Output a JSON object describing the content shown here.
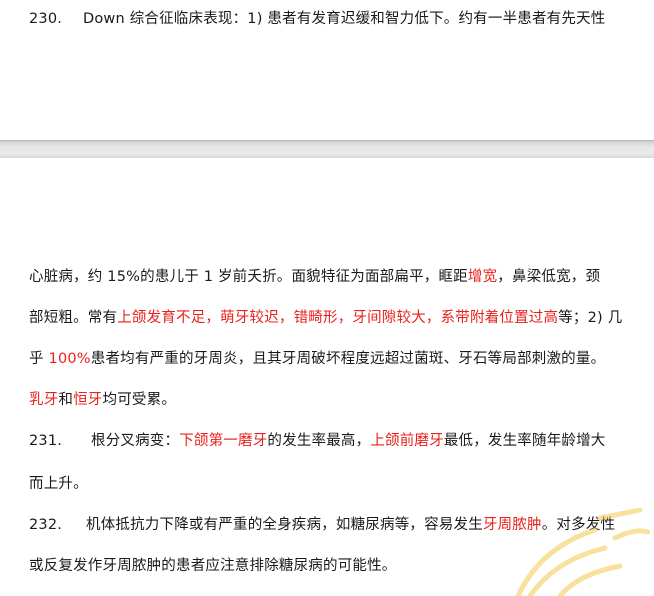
{
  "page1": {
    "item230_num": "230.",
    "item230_text": "Down 综合征临床表现：1) 患者有发育迟缓和智力低下。约有一半患者有先天性"
  },
  "page2": {
    "l1": [
      "心脏病，约 15%的患儿于 1 岁前夭折。面貌特征为面部扁平，眶距",
      "增宽",
      "，鼻梁低宽，颈"
    ],
    "l2": [
      "部短粗。常有",
      "上颌发育不足，萌牙较迟，错畸形，牙间隙较大，系带附着位置过高",
      "等；2) 几"
    ],
    "l3": [
      "乎 ",
      "100%",
      "患者均有严重的牙周炎，且其牙周破坏程度远超过菌斑、牙石等局部刺激的量。"
    ],
    "l4": [
      "乳牙",
      "和",
      "恒牙",
      "均可受累。"
    ],
    "item231_num": "231.",
    "l5": [
      "根分叉病变：",
      "下颌第一磨牙",
      "的发生率最高，",
      "上颌前磨牙",
      "最低，发生率随年龄增大"
    ],
    "l6": "而上升。",
    "item232_num": "232.",
    "l7": [
      "机体抵抗力下降或有严重的全身疾病，如糖尿病等，容易发生",
      "牙周脓肿",
      "。对多发性"
    ],
    "l8": "或反复发作牙周脓肿的患者应注意排除糖尿病的可能性。"
  },
  "colors": {
    "highlight": "#e8211c",
    "text": "#1a1a1a",
    "watermark": "#f2c94c"
  }
}
